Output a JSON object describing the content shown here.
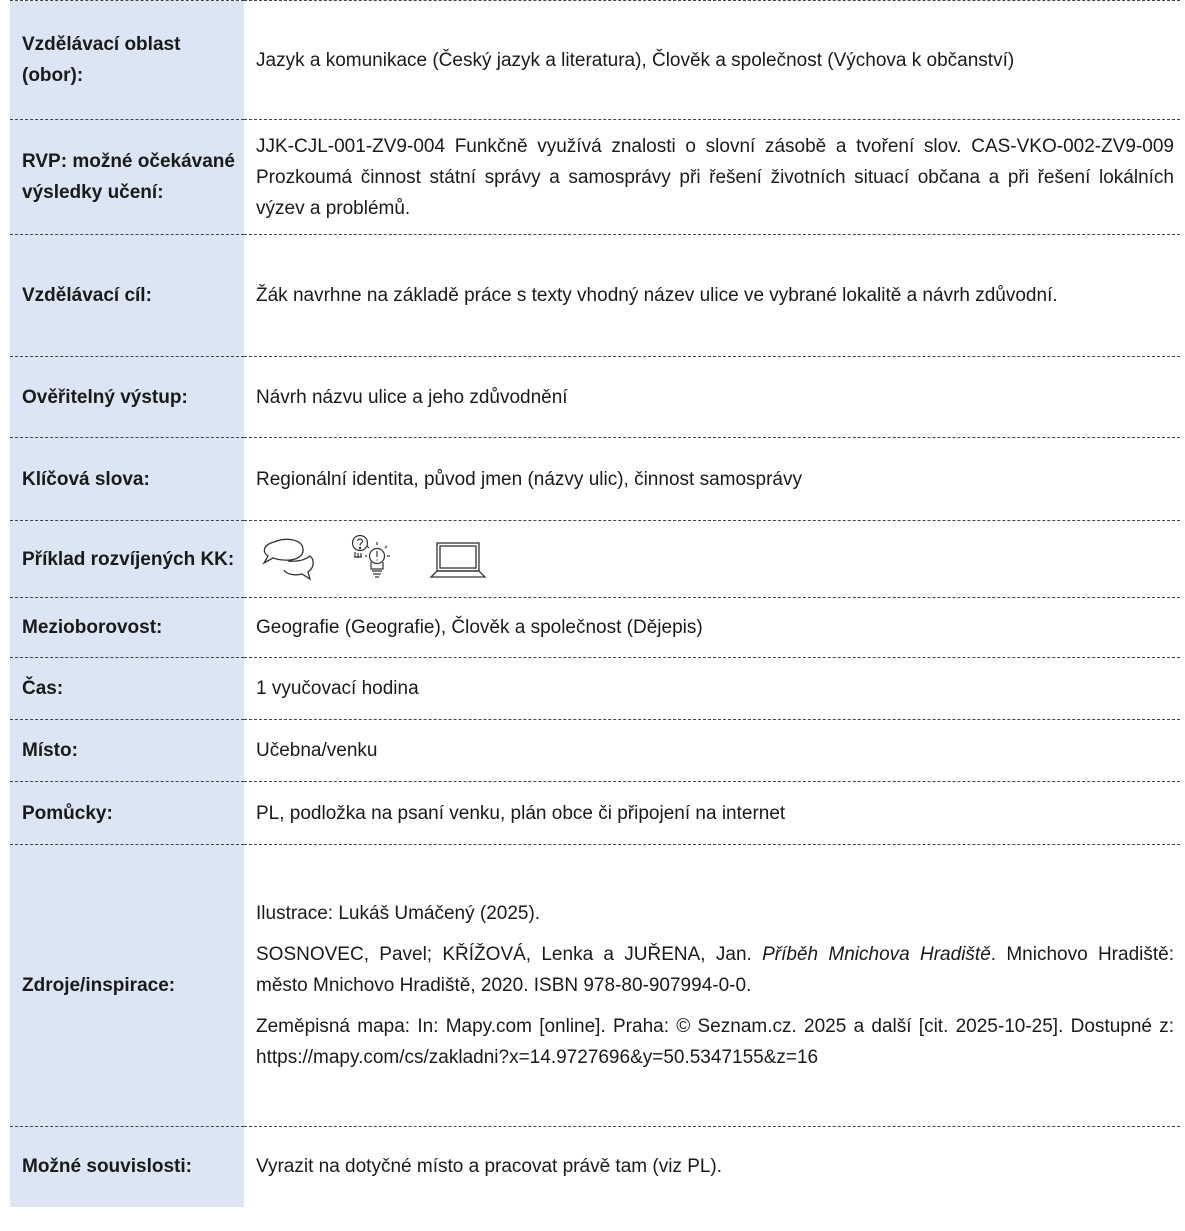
{
  "rows": [
    {
      "label": "Vzdělávací oblast (obor):",
      "value": "Jazyk a komunikace (Český jazyk a literatura), Člověk a společnost (Výchova k občanství)"
    },
    {
      "label": "RVP: možné očekávané výsledky učení:",
      "value": "JJK-CJL-001-ZV9-004 Funkčně využívá znalosti o slovní zásobě a tvoření slov. CAS-VKO-002-ZV9-009 Prozkoumá činnost státní správy a samosprávy při řešení životních situací občana a při řešení lokálních výzev a problémů."
    },
    {
      "label": "Vzdělávací cíl:",
      "value": "Žák navrhne na základě práce s texty vhodný název ulice ve vybrané lokalitě a návrh zdůvodní."
    },
    {
      "label": "Ověřitelný výstup:",
      "value": "Návrh názvu ulice a jeho zdůvodnění"
    },
    {
      "label": "Klíčová slova:",
      "value": "Regionální identita, původ jmen (názvy ulic), činnost samosprávy"
    },
    {
      "label": "Příklad rozvíjených KK:",
      "icons": [
        "speech-bubbles-icon",
        "question-lightbulb-icon",
        "laptop-icon"
      ]
    },
    {
      "label": "Mezioborovost:",
      "value": "Geografie (Geografie), Člověk a společnost (Dějepis)"
    },
    {
      "label": "Čas:",
      "value": "1 vyučovací hodina"
    },
    {
      "label": "Místo:",
      "value": "Učebna/venku"
    },
    {
      "label": "Pomůcky:",
      "value": "PL, podložka na psaní venku, plán obce či připojení na internet"
    },
    {
      "label": "Zdroje/inspirace:",
      "sources": {
        "illustration": "Ilustrace: Lukáš Umáčený (2025).",
        "book_authors": "SOSNOVEC, Pavel; KŘÍŽOVÁ, Lenka a JUŘENA, Jan. ",
        "book_title": "Příběh Mnichova Hradiště",
        "book_rest": ". Mnichovo Hradiště: město Mnichovo Hradiště, 2020. ISBN 978-80-907994-0-0.",
        "map": "Zeměpisná mapa: In: Mapy.com [online]. Praha: © Seznam.cz. 2025 a další [cit. 2025-10-25]. Dostupné z: https://mapy.com/cs/zakladni?x=14.9727696&y=50.5347155&z=16"
      }
    },
    {
      "label": "Možné souvislosti:",
      "value": "Vyrazit na dotyčné místo a pracovat právě tam (viz PL)."
    }
  ],
  "colors": {
    "label_bg": "#dbe5f4",
    "label_text": "#3d6aa8",
    "border": "#444444"
  }
}
